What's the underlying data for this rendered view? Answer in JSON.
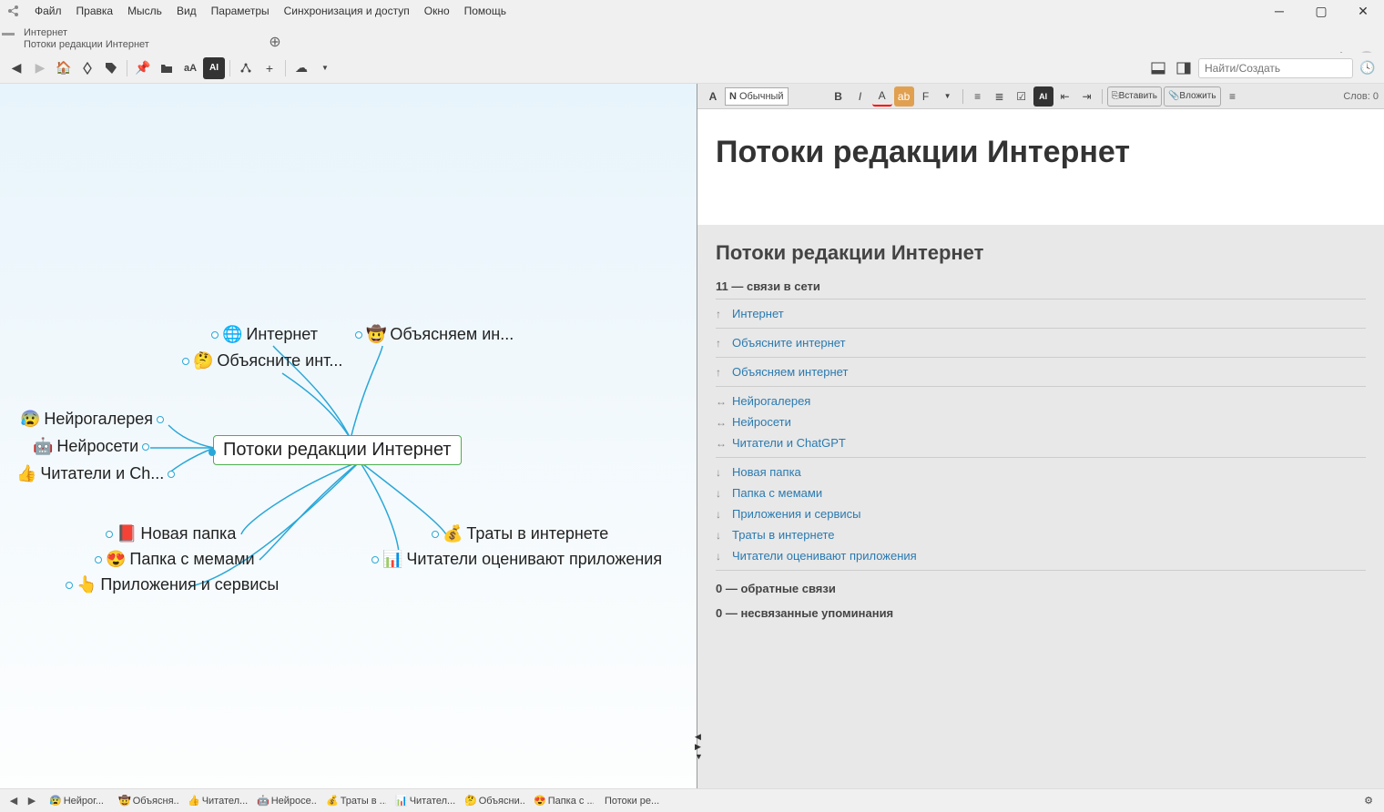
{
  "menu": {
    "items": [
      "Файл",
      "Правка",
      "Мысль",
      "Вид",
      "Параметры",
      "Синхронизация и доступ",
      "Окно",
      "Помощь"
    ]
  },
  "tab": {
    "line1": "Интернет",
    "line2": "Потоки редакции Интернет"
  },
  "toolbar": {
    "search_ph": "Найти/Создать"
  },
  "fmt": {
    "style": "Обычный",
    "insert": "Вставить",
    "attach": "Вложить",
    "wc": "Слов: 0"
  },
  "doc": {
    "title": "Потоки редакции Интернет",
    "heading": "Потоки редакции Интернет",
    "sub1": "11 — связи в сети",
    "parents": [
      "Интернет",
      "Объясните интернет",
      "Объясняем интернет"
    ],
    "jumps": [
      "Нейрогалерея",
      "Нейросети",
      "Читатели и ChatGPT"
    ],
    "children": [
      "Новая папка",
      "Папка с мемами",
      "Приложения и сервисы",
      "Траты в интернете",
      "Читатели оценивают приложения"
    ],
    "sub2": "0 — обратные связи",
    "sub3": "0 — несвязанные упоминания"
  },
  "nodes": {
    "center": "Потоки редакции Интернет",
    "p1": {
      "icon": "🌐",
      "label": "Интернет"
    },
    "p2": {
      "icon": "🤠",
      "label": "Объясняем ин..."
    },
    "p3": {
      "icon": "🤔",
      "label": "Объясните инт..."
    },
    "j1": {
      "icon": "😰",
      "label": "Нейрогалерея"
    },
    "j2": {
      "icon": "🤖",
      "label": "Нейросети"
    },
    "j3": {
      "icon": "👍",
      "label": "Читатели и Ch..."
    },
    "c1": {
      "icon": "📕",
      "label": "Новая папка"
    },
    "c2": {
      "icon": "😍",
      "label": "Папка с мемами"
    },
    "c3": {
      "icon": "👆",
      "label": "Приложения и сервисы"
    },
    "c4": {
      "icon": "💰",
      "label": "Траты в интернете"
    },
    "c5": {
      "icon": "📊",
      "label": "Читатели оценивают приложения"
    }
  },
  "crumbs": [
    {
      "icon": "😰",
      "label": "Нейрог..."
    },
    {
      "icon": "🤠",
      "label": "Объясня..."
    },
    {
      "icon": "👍",
      "label": "Читател..."
    },
    {
      "icon": "🤖",
      "label": "Нейросе..."
    },
    {
      "icon": "💰",
      "label": "Траты в ..."
    },
    {
      "icon": "📊",
      "label": "Читател..."
    },
    {
      "icon": "🤔",
      "label": "Объясни..."
    },
    {
      "icon": "😍",
      "label": "Папка с ..."
    },
    {
      "icon": "",
      "label": "Потоки ре..."
    }
  ]
}
